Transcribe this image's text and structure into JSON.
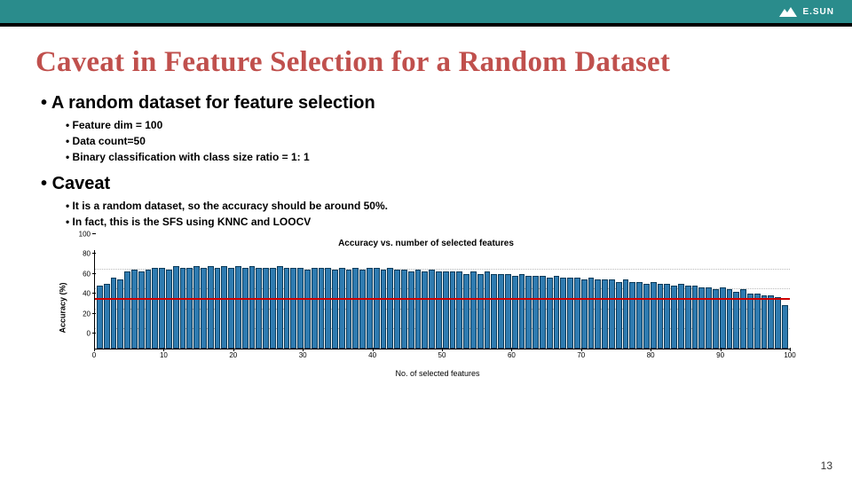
{
  "brand": {
    "name": "E.SUN"
  },
  "title": "Caveat in Feature Selection for a Random Dataset",
  "bullets": {
    "b1a": "A random dataset for feature selection",
    "b1a_sub": [
      "Feature dim = 100",
      "Data count=50",
      "Binary classification with class size ratio = 1: 1"
    ],
    "b1b": "Caveat",
    "b1b_sub": [
      "It is a random dataset, so the accuracy should be around 50%.",
      "In fact, this is the SFS using KNNC and LOOCV"
    ]
  },
  "chart_data": {
    "type": "bar",
    "title": "Accuracy vs. number of selected features",
    "xlabel": "No. of selected features",
    "ylabel": "Accuracy (%)",
    "ylim": [
      0,
      100
    ],
    "yticks": [
      0,
      20,
      40,
      60,
      80,
      100
    ],
    "xticks": [
      0,
      10,
      20,
      30,
      40,
      50,
      60,
      70,
      80,
      90,
      100
    ],
    "reference_line": 50,
    "x": [
      1,
      2,
      3,
      4,
      5,
      6,
      7,
      8,
      9,
      10,
      11,
      12,
      13,
      14,
      15,
      16,
      17,
      18,
      19,
      20,
      21,
      22,
      23,
      24,
      25,
      26,
      27,
      28,
      29,
      30,
      31,
      32,
      33,
      34,
      35,
      36,
      37,
      38,
      39,
      40,
      41,
      42,
      43,
      44,
      45,
      46,
      47,
      48,
      49,
      50,
      51,
      52,
      53,
      54,
      55,
      56,
      57,
      58,
      59,
      60,
      61,
      62,
      63,
      64,
      65,
      66,
      67,
      68,
      69,
      70,
      71,
      72,
      73,
      74,
      75,
      76,
      77,
      78,
      79,
      80,
      81,
      82,
      83,
      84,
      85,
      86,
      87,
      88,
      89,
      90,
      91,
      92,
      93,
      94,
      95,
      96,
      97,
      98,
      99,
      100
    ],
    "values": [
      64,
      66,
      72,
      70,
      78,
      80,
      78,
      80,
      82,
      82,
      80,
      84,
      82,
      82,
      84,
      82,
      84,
      82,
      84,
      82,
      84,
      82,
      84,
      82,
      82,
      82,
      84,
      82,
      82,
      82,
      80,
      82,
      82,
      82,
      80,
      82,
      80,
      82,
      80,
      82,
      82,
      80,
      82,
      80,
      80,
      78,
      80,
      78,
      80,
      78,
      78,
      78,
      78,
      76,
      78,
      76,
      78,
      76,
      76,
      76,
      74,
      76,
      74,
      74,
      74,
      72,
      74,
      72,
      72,
      72,
      70,
      72,
      70,
      70,
      70,
      68,
      70,
      68,
      68,
      66,
      68,
      66,
      66,
      64,
      66,
      64,
      64,
      62,
      62,
      60,
      62,
      60,
      58,
      60,
      56,
      56,
      54,
      54,
      52,
      44
    ]
  },
  "page_number": "13"
}
